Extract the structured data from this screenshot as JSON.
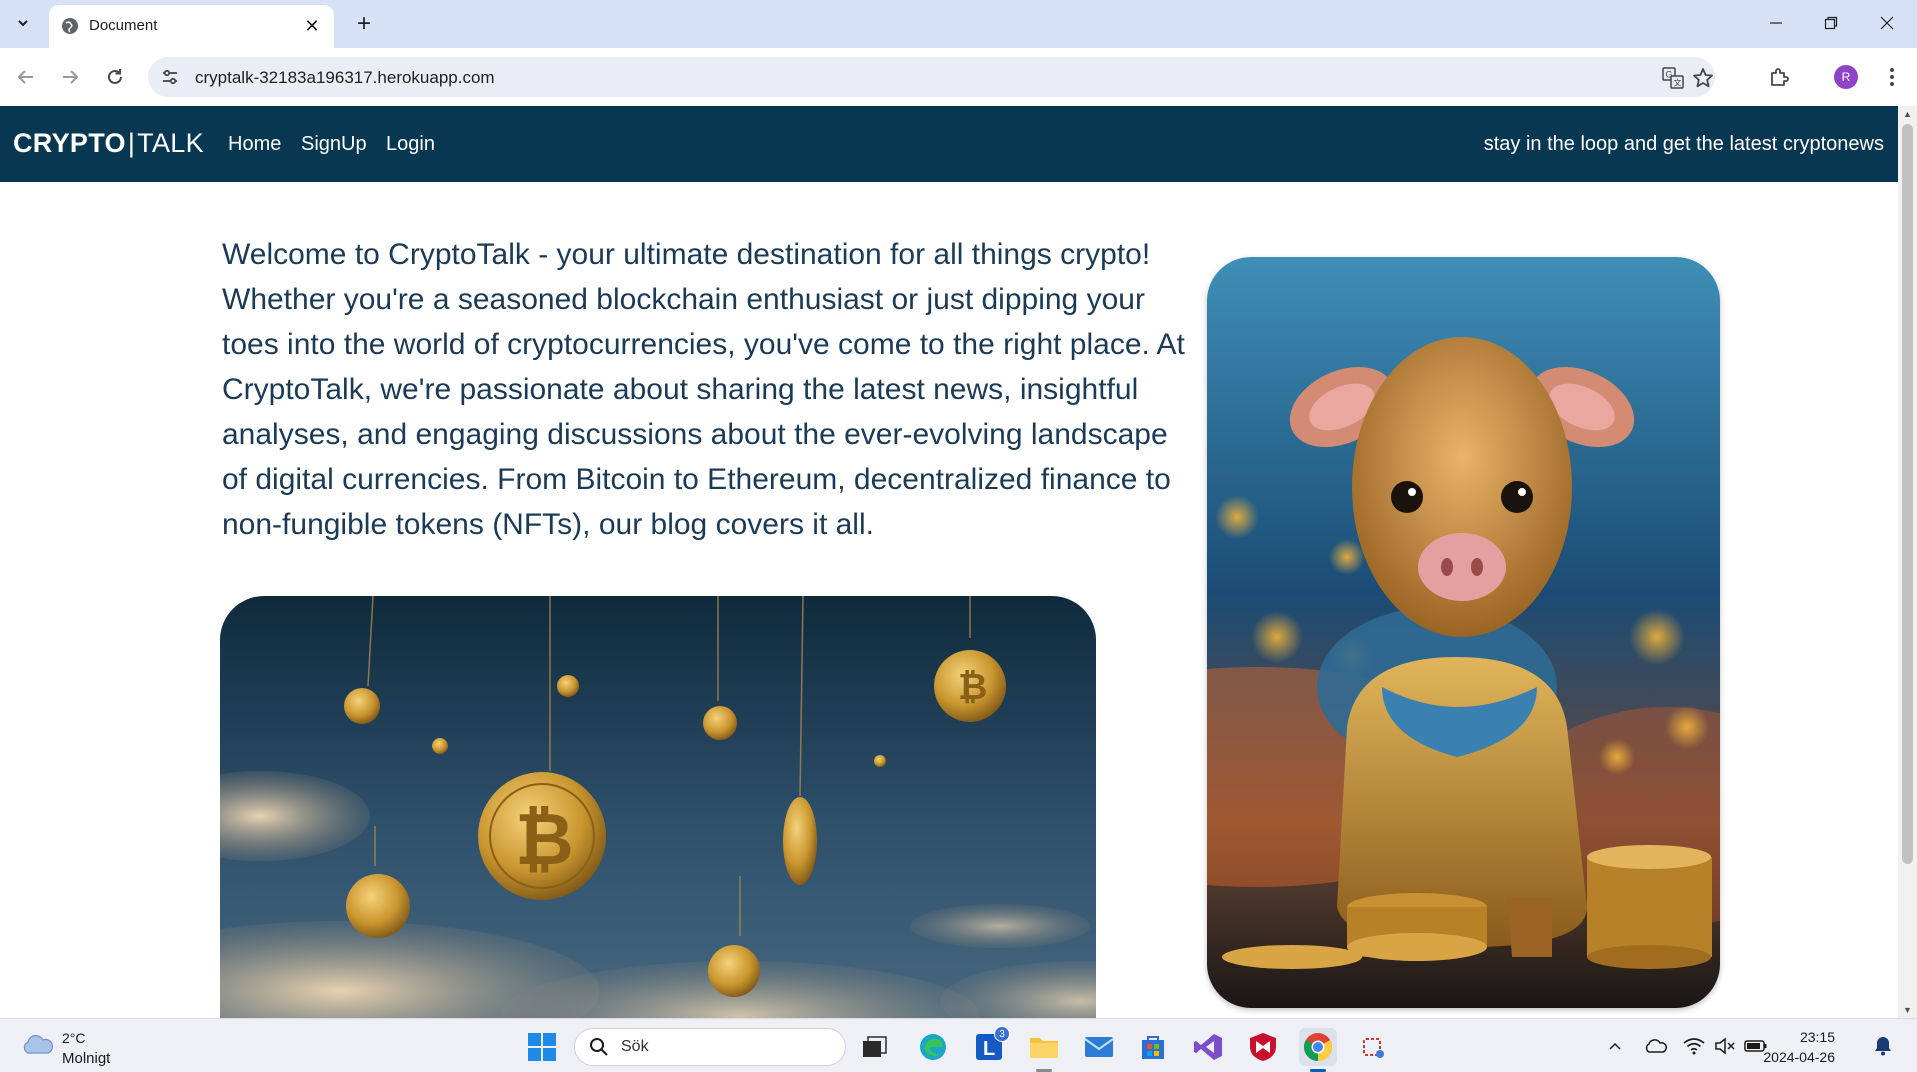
{
  "browser": {
    "tab": {
      "title": "Document",
      "favicon": "globe-icon"
    },
    "url": "cryptalk-32183a196317.herokuapp.com",
    "profile_initial": "R",
    "colors": {
      "tabstrip": "#d6e1f6",
      "omnibox": "#e9eef6"
    }
  },
  "site": {
    "brand": {
      "strong": "CRYPTO",
      "sep": "|",
      "light": "TALK"
    },
    "nav": {
      "home": "Home",
      "signup": "SignUp",
      "login": "Login"
    },
    "tagline": "stay in the loop and get the latest cryptonews",
    "intro": "Welcome to CryptoTalk - your ultimate destination for all things crypto! Whether you're a seasoned blockchain enthusiast or just dipping your toes into the world of cryptocurrencies, you've come to the right place. At CryptoTalk, we're passionate about sharing the latest news, insightful analyses, and engaging discussions about the ever-evolving landscape of digital currencies. From Bitcoin to Ethereum, decentralized finance to non-fungible tokens (NFTs), our blog covers it all.",
    "colors": {
      "navbar": "#083752",
      "text": "#1b3a56"
    },
    "images": [
      "bitcoin-coins-sky-image",
      "golden-calf-coins-image"
    ]
  },
  "taskbar": {
    "weather": {
      "temp": "2°C",
      "condition": "Molnigt"
    },
    "search_placeholder": "Sök",
    "mail_badge": "3",
    "clock": {
      "time": "23:15",
      "date": "2024-04-26"
    }
  }
}
